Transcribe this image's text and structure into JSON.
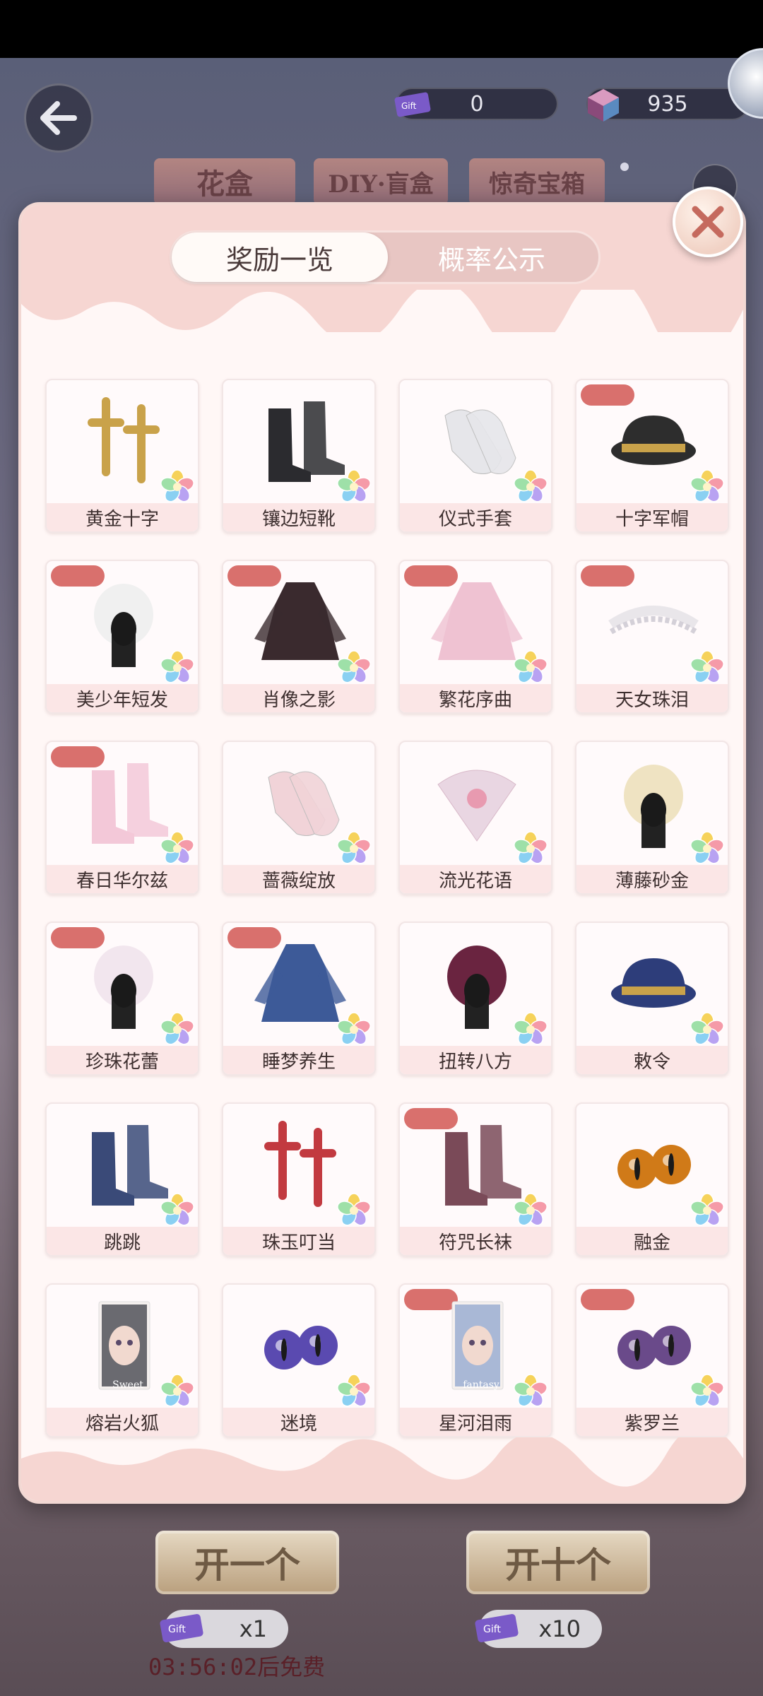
{
  "header": {
    "currency_ticket_value": "0",
    "currency_gem_value": "935",
    "top_tabs": [
      "花盒",
      "DIY·盲盒",
      "惊奇宝箱"
    ]
  },
  "modal": {
    "tabs": [
      {
        "label": "奖励一览",
        "active": true
      },
      {
        "label": "概率公示",
        "active": false
      }
    ],
    "items": [
      {
        "name": "黄金十字",
        "tag": false,
        "icon": "gold-cross-earrings-icon",
        "color": "#c9a24a"
      },
      {
        "name": "镶边短靴",
        "tag": false,
        "icon": "black-boots-icon",
        "color": "#2b2b2f"
      },
      {
        "name": "仪式手套",
        "tag": false,
        "icon": "white-gloves-icon",
        "color": "#e6e6ea"
      },
      {
        "name": "十字军帽",
        "tag": true,
        "icon": "military-cap-icon",
        "color": "#2d2d2d"
      },
      {
        "name": "美少年短发",
        "tag": true,
        "icon": "white-short-hair-icon",
        "color": "#f0f0f0"
      },
      {
        "name": "肖像之影",
        "tag": true,
        "icon": "dark-coat-outfit-icon",
        "color": "#3a2a2e"
      },
      {
        "name": "繁花序曲",
        "tag": true,
        "icon": "pink-dress-icon",
        "color": "#efc2d2"
      },
      {
        "name": "天女珠泪",
        "tag": true,
        "icon": "pearl-headband-icon",
        "color": "#e9e6ea"
      },
      {
        "name": "春日华尔兹",
        "tag": true,
        "icon": "pink-shoes-icon",
        "color": "#f3c8d8"
      },
      {
        "name": "蔷薇绽放",
        "tag": false,
        "icon": "rose-gloves-icon",
        "color": "#f1d3d8"
      },
      {
        "name": "流光花语",
        "tag": false,
        "icon": "flower-fan-icon",
        "color": "#e9d6e2"
      },
      {
        "name": "薄藤砂金",
        "tag": false,
        "icon": "blonde-curls-icon",
        "color": "#efe3c2"
      },
      {
        "name": "珍珠花蕾",
        "tag": true,
        "icon": "pearl-hairpin-icon",
        "color": "#f2e6ee"
      },
      {
        "name": "睡梦养生",
        "tag": true,
        "icon": "blue-jacket-icon",
        "color": "#3d5a98"
      },
      {
        "name": "扭转八方",
        "tag": false,
        "icon": "braided-hair-icon",
        "color": "#6a2440"
      },
      {
        "name": "敕令",
        "tag": false,
        "icon": "blue-hat-icon",
        "color": "#2d3d7a"
      },
      {
        "name": "跳跳",
        "tag": false,
        "icon": "blue-boots-icon",
        "color": "#3a4a78"
      },
      {
        "name": "珠玉叮当",
        "tag": false,
        "icon": "tassel-earrings-icon",
        "color": "#c23a40"
      },
      {
        "name": "符咒长袜",
        "tag": true,
        "icon": "long-stockings-icon",
        "color": "#7a4a58"
      },
      {
        "name": "融金",
        "tag": false,
        "icon": "gold-eyes-icon",
        "color": "#d07a18"
      },
      {
        "name": "熔岩火狐",
        "tag": false,
        "icon": "portrait-card-icon",
        "color": "#6a6a70",
        "card_text": "Sweet"
      },
      {
        "name": "迷境",
        "tag": false,
        "icon": "galaxy-eyes-icon",
        "color": "#5a4ab0"
      },
      {
        "name": "星河泪雨",
        "tag": true,
        "icon": "portrait-card-icon",
        "color": "#a9b8d6",
        "card_text": "fantasy"
      },
      {
        "name": "紫罗兰",
        "tag": true,
        "icon": "violet-eyes-icon",
        "color": "#6a4a8a"
      }
    ]
  },
  "bottom": {
    "open_one_label": "开一个",
    "open_ten_label": "开十个",
    "cost_one": "x1",
    "cost_ten": "x10",
    "timer_text": "03:56:02后免费"
  }
}
